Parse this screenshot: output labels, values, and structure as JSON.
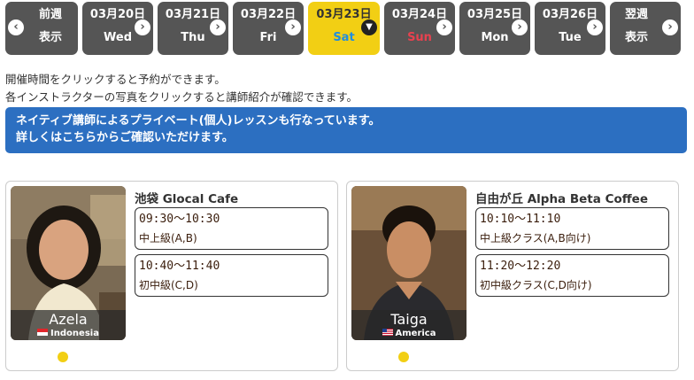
{
  "date_nav": {
    "prev": {
      "line1": "前週",
      "line2": "表示"
    },
    "days": [
      {
        "date": "03月20日",
        "weekday": "Wed",
        "type": "normal"
      },
      {
        "date": "03月21日",
        "weekday": "Thu",
        "type": "normal"
      },
      {
        "date": "03月22日",
        "weekday": "Fri",
        "type": "normal"
      },
      {
        "date": "03月23日",
        "weekday": "Sat",
        "type": "selected"
      },
      {
        "date": "03月24日",
        "weekday": "Sun",
        "type": "sunday"
      },
      {
        "date": "03月25日",
        "weekday": "Mon",
        "type": "normal"
      },
      {
        "date": "03月26日",
        "weekday": "Tue",
        "type": "normal"
      }
    ],
    "next": {
      "line1": "翌週",
      "line2": "表示"
    }
  },
  "notes": {
    "line1": "開催時間をクリックすると予約ができます。",
    "line2": "各インストラクターの写真をクリックすると講師紹介が確認できます。"
  },
  "banner": {
    "line1": "ネイティブ講師によるプライベート(個人)レッスンも行なっています。",
    "line2": "詳しくはこちらからご確認いただけます。"
  },
  "lessons": [
    {
      "instructor": "Azela",
      "country": "Indonesia",
      "venue": "池袋 Glocal Cafe",
      "slots": [
        {
          "time": "09:30〜10:30",
          "level": "中上級(A,B)"
        },
        {
          "time": "10:40〜11:40",
          "level": "初中級(C,D)"
        }
      ]
    },
    {
      "instructor": "Taiga",
      "country": "America",
      "venue": "自由が丘 Alpha Beta Coffee",
      "slots": [
        {
          "time": "10:10〜11:10",
          "level": "中上級クラス(A,B向け)"
        },
        {
          "time": "11:20〜12:20",
          "level": "初中級クラス(C,D向け)"
        }
      ]
    }
  ],
  "colors": {
    "day_button": "#555555",
    "selected_day": "#f2cf14",
    "sat_text": "#1f8de0",
    "sun_text": "#e8414f",
    "banner": "#2c6fc1",
    "indicator_dot": "#f2cf14"
  }
}
